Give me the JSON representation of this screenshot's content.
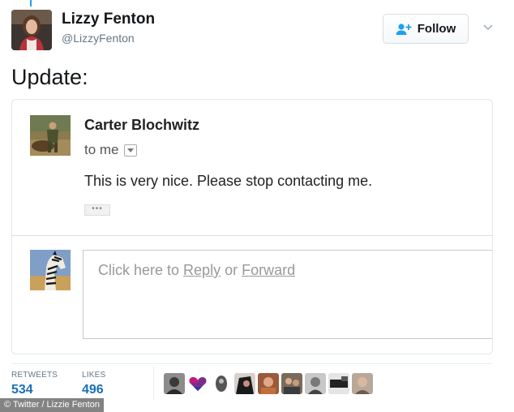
{
  "tweet": {
    "author_name": "Lizzy Fenton",
    "author_handle": "@LizzyFenton",
    "follow_label": "Follow",
    "text": "Update:"
  },
  "email": {
    "sender": "Carter Blochwitz",
    "to_line": "to me",
    "body": "This is very nice. Please stop contacting me.",
    "trimmed_content_label": "•••",
    "reply_prompt_prefix": "Click here to ",
    "reply_link": "Reply",
    "reply_middle": " or ",
    "forward_link": "Forward"
  },
  "stats": {
    "retweets_label": "RETWEETS",
    "retweets_value": "534",
    "likes_label": "LIKES",
    "likes_value": "496"
  },
  "credit": "© Twitter / Lizzie Fenton",
  "colors": {
    "twitter_blue": "#1da1f2",
    "stat_blue": "#1b6fb6",
    "text_dark": "#14171a",
    "text_muted": "#657786"
  },
  "icons": {
    "follow": "person-plus-icon",
    "menu": "chevron-down-icon",
    "email_dropdown": "caret-down-icon"
  }
}
